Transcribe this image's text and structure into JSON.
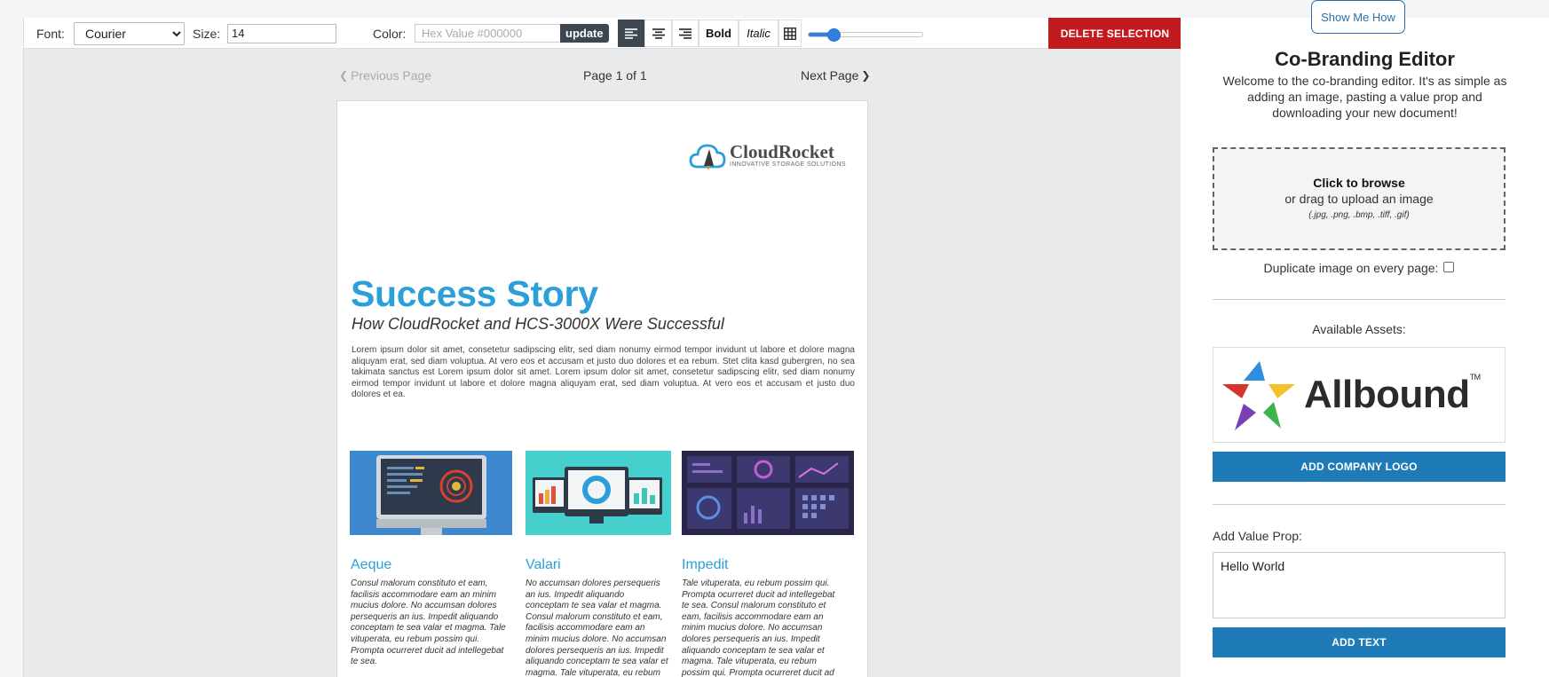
{
  "toolbar": {
    "font_label": "Font:",
    "font_value": "Courier",
    "size_label": "Size:",
    "size_value": "14",
    "color_label": "Color:",
    "hex_placeholder": "Hex Value #000000",
    "update_label": "update",
    "bold_label": "Bold",
    "italic_label": "Italic",
    "slider_fraction": 0.18,
    "delete_label": "DELETE SELECTION",
    "accent_color": "#2f7fe0",
    "delete_color": "#c21a1f"
  },
  "pager": {
    "prev_label": "Previous Page",
    "status": "Page 1 of 1",
    "next_label": "Next Page"
  },
  "document": {
    "logo_name": "CloudRocket",
    "logo_tagline": "INNOVATIVE STORAGE SOLUTIONS",
    "title": "Success Story",
    "subtitle": "How CloudRocket and HCS-3000X Were Successful",
    "body": "Lorem ipsum dolor sit amet, consetetur sadipscing elitr, sed diam nonumy eirmod tempor invidunt ut labore et dolore magna aliquyam erat, sed diam voluptua. At vero eos et accusam et justo duo dolores et ea rebum. Stet clita kasd gubergren, no sea takimata sanctus est Lorem ipsum dolor sit amet. Lorem ipsum dolor sit amet, consetetur sadipscing elitr, sed diam nonumy eirmod tempor invidunt ut labore et dolore magna aliquyam erat, sed diam voluptua. At vero eos et accusam et justo duo dolores et ea.",
    "title_color": "#2a9fd8",
    "columns": [
      {
        "heading": "Aeque",
        "text": "Consul malorum constituto et eam, facilisis accommodare eam an minim mucius dolore. No accumsan dolores persequeris an ius. Impedit aliquando conceptam te sea valar et magma. Tale vituperata, eu rebum possim qui. Prompta ocurreret ducit ad intellegebat te sea."
      },
      {
        "heading": "Valari",
        "text": "No accumsan dolores persequeris an ius. Impedit aliquando conceptam te sea valar et magma. Consul malorum constituto et eam, facilisis accommodare eam an minim mucius dolore. No accumsan dolores persequeris an ius. Impedit aliquando conceptam te sea valar et magma. Tale vituperata, eu rebum possim qui."
      },
      {
        "heading": "Impedit",
        "text": "Tale vituperata, eu rebum possim qui. Prompta ocurreret ducit ad intellegebat te sea. Consul malorum constituto et eam, facilisis accommodare eam an minim mucius dolore. No accumsan dolores persequeris an ius. Impedit aliquando conceptam te sea valar et magma. Tale vituperata, eu rebum possim qui. Prompta ocurreret ducit ad intellegebat te sea."
      }
    ]
  },
  "sidebar": {
    "show_me_label": "Show Me How",
    "title": "Co-Branding Editor",
    "intro": "Welcome to the co-branding editor. It's as simple as adding an image, pasting a value prop and downloading your new document!",
    "upload_primary": "Click to browse",
    "upload_secondary": "or drag to upload an image",
    "upload_formats": "(.jpg, .png, .bmp, .tiff, .gif)",
    "duplicate_label": "Duplicate image on every page:",
    "assets_label": "Available Assets:",
    "asset_name": "Allbound",
    "asset_tm": "TM",
    "add_logo_label": "ADD COMPANY LOGO",
    "value_prop_label": "Add Value Prop:",
    "value_prop_text": "Hello World",
    "add_text_label": "ADD TEXT",
    "button_color": "#1f7bb8"
  }
}
